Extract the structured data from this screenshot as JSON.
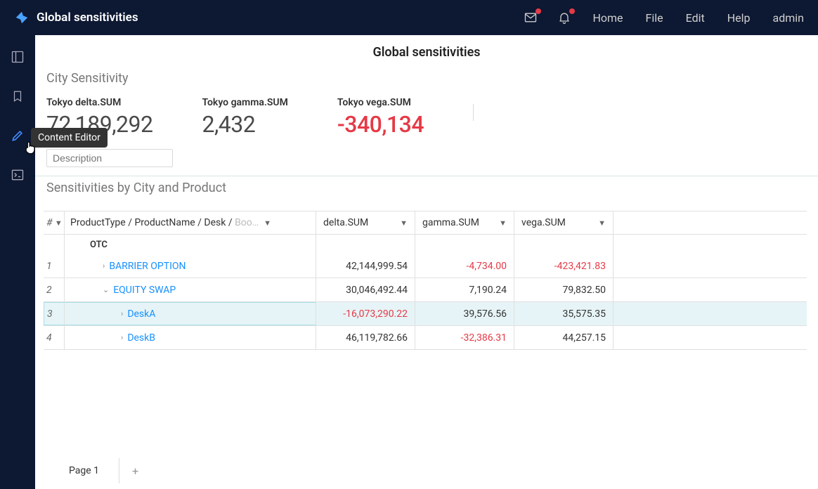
{
  "header": {
    "title": "Global sensitivities",
    "nav": [
      "Home",
      "File",
      "Edit",
      "Help",
      "admin"
    ],
    "tooltip": "Content Editor"
  },
  "page": {
    "title": "Global sensitivities",
    "section1_title": "City Sensitivity",
    "section2_title": "Sensitivities by City and Product",
    "description_placeholder": "Description"
  },
  "kpis": [
    {
      "label": "Tokyo delta.SUM",
      "value": "72,189,292",
      "neg": false
    },
    {
      "label": "Tokyo gamma.SUM",
      "value": "2,432",
      "neg": false
    },
    {
      "label": "Tokyo vega.SUM",
      "value": "-340,134",
      "neg": true
    }
  ],
  "table": {
    "idx_symbol": "#",
    "hier_header": "ProductType / ProductName / Desk /",
    "hier_muted": "Boo…",
    "cols": [
      "delta.SUM",
      "gamma.SUM",
      "vega.SUM"
    ],
    "otc_label": "OTC",
    "rows": [
      {
        "idx": "1",
        "indent": 1,
        "expanded": false,
        "label": "BARRIER OPTION",
        "v": [
          "42,144,999.54",
          "-4,734.00",
          "-423,421.83"
        ],
        "neg": [
          false,
          true,
          true
        ]
      },
      {
        "idx": "2",
        "indent": 1,
        "expanded": true,
        "label": "EQUITY SWAP",
        "v": [
          "30,046,492.44",
          "7,190.24",
          "79,832.50"
        ],
        "neg": [
          false,
          false,
          false
        ]
      },
      {
        "idx": "3",
        "indent": 2,
        "expanded": false,
        "label": "DeskA",
        "v": [
          "-16,073,290.22",
          "39,576.56",
          "35,575.35"
        ],
        "neg": [
          true,
          false,
          false
        ],
        "hover": true
      },
      {
        "idx": "4",
        "indent": 2,
        "expanded": false,
        "label": "DeskB",
        "v": [
          "46,119,782.66",
          "-32,386.31",
          "44,257.15"
        ],
        "neg": [
          false,
          true,
          false
        ]
      }
    ]
  },
  "tabs": {
    "page_label": "Page 1",
    "add": "+"
  }
}
